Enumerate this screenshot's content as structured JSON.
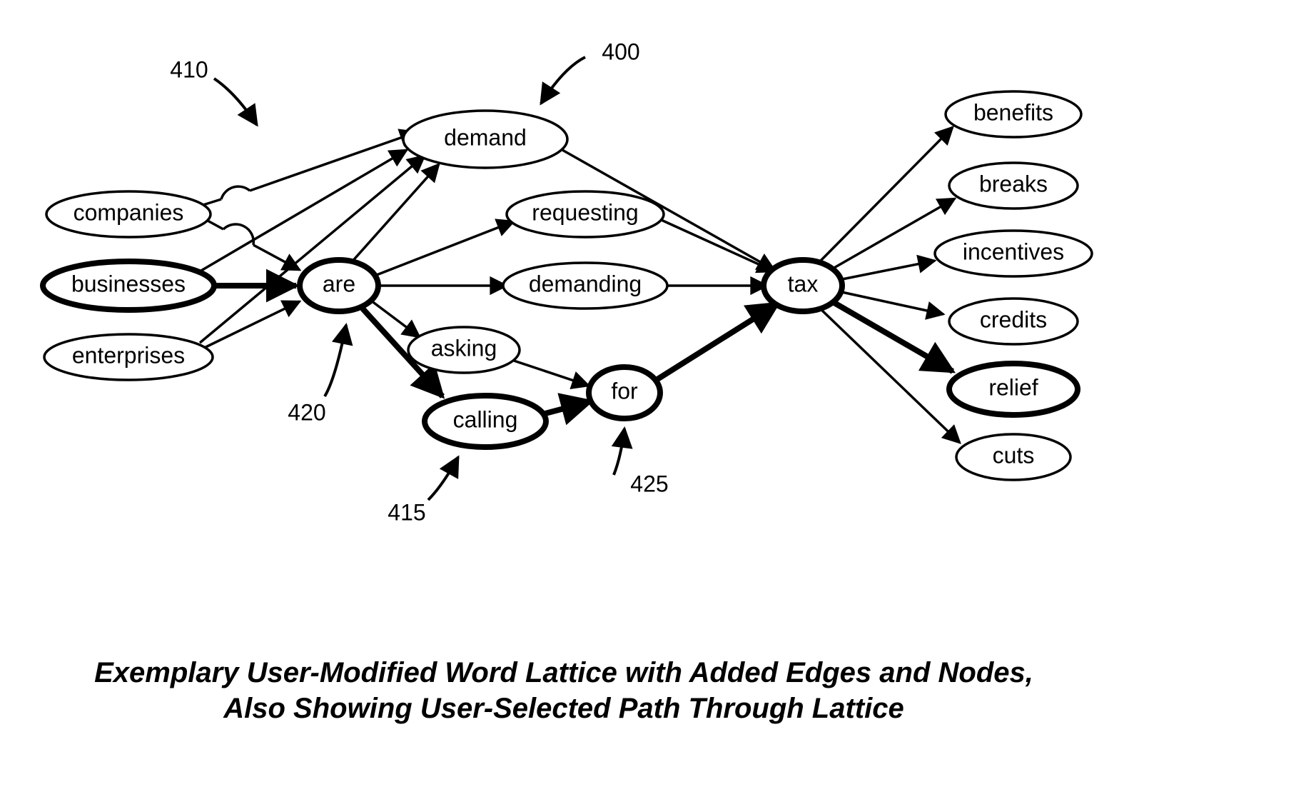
{
  "caption": {
    "line1": "Exemplary User-Modified Word Lattice with Added Edges and Nodes,",
    "line2": "Also Showing User-Selected Path Through Lattice"
  },
  "annotations": {
    "a400": "400",
    "a410": "410",
    "a415": "415",
    "a420": "420",
    "a425": "425"
  },
  "nodes": {
    "companies": "companies",
    "businesses": "businesses",
    "enterprises": "enterprises",
    "are": "are",
    "demand": "demand",
    "requesting": "requesting",
    "demanding": "demanding",
    "asking": "asking",
    "calling": "calling",
    "for": "for",
    "tax": "tax",
    "benefits": "benefits",
    "breaks": "breaks",
    "incentives": "incentives",
    "credits": "credits",
    "relief": "relief",
    "cuts": "cuts"
  }
}
